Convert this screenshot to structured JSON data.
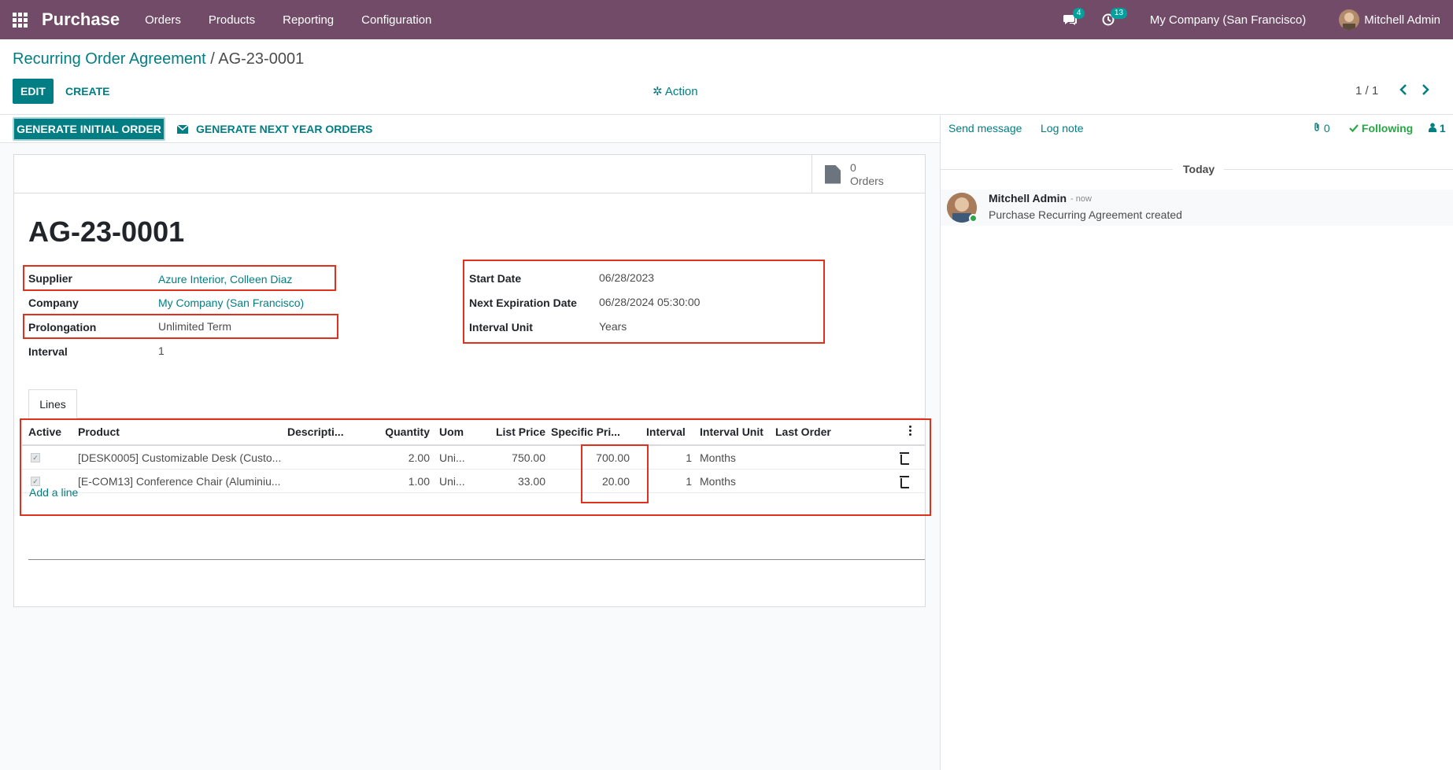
{
  "navbar": {
    "app_name": "Purchase",
    "menu": [
      "Orders",
      "Products",
      "Reporting",
      "Configuration"
    ],
    "messages_count": "4",
    "activities_count": "13",
    "company": "My Company (San Francisco)",
    "user": "Mitchell Admin"
  },
  "breadcrumb": {
    "parent": "Recurring Order Agreement",
    "separator": " / ",
    "current": "AG-23-0001"
  },
  "control_panel": {
    "edit_label": "EDIT",
    "create_label": "CREATE",
    "action_label": "✲ Action",
    "pager": "1 / 1"
  },
  "statusbar": {
    "generate_initial": "GENERATE INITIAL ORDER",
    "generate_next": "GENERATE NEXT YEAR ORDERS"
  },
  "stat_button": {
    "value": "0",
    "label": "Orders"
  },
  "record": {
    "name": "AG-23-0001",
    "left_fields": [
      {
        "label": "Supplier",
        "value": "Azure Interior, Colleen Diaz"
      },
      {
        "label": "Company",
        "value": "My Company (San Francisco)"
      },
      {
        "label": "Prolongation",
        "value": "Unlimited Term"
      },
      {
        "label": "Interval",
        "value": "1"
      }
    ],
    "right_fields": [
      {
        "label": "Start Date",
        "value": "06/28/2023"
      },
      {
        "label": "Next Expiration Date",
        "value": "06/28/2024 05:30:00"
      },
      {
        "label": "Interval Unit",
        "value": "Years"
      }
    ]
  },
  "tabs": {
    "lines": "Lines"
  },
  "lines_table": {
    "headers": [
      "Active",
      "Product",
      "Descripti...",
      "Quantity",
      "Uom",
      "List Price",
      "Specific Pri...",
      "Interval",
      "Interval Unit",
      "Last Order"
    ],
    "rows": [
      {
        "active": "✓",
        "product": "[DESK0005] Customizable Desk (Custo...",
        "description": "",
        "quantity": "2.00",
        "uom": "Uni...",
        "list_price": "750.00",
        "specific_price": "700.00",
        "interval": "1",
        "interval_unit": "Months",
        "last_order": ""
      },
      {
        "active": "✓",
        "product": "[E-COM13] Conference Chair (Aluminiu...",
        "description": "",
        "quantity": "1.00",
        "uom": "Uni...",
        "list_price": "33.00",
        "specific_price": "20.00",
        "interval": "1",
        "interval_unit": "Months",
        "last_order": ""
      }
    ],
    "add_line": "Add a line"
  },
  "chatter": {
    "send_message": "Send message",
    "log_note": "Log note",
    "attachments": "0",
    "following": "Following",
    "followers": "1",
    "date_separator": "Today",
    "messages": [
      {
        "author": "Mitchell Admin",
        "date": "- now",
        "body": "Purchase Recurring Agreement created"
      }
    ]
  },
  "colors": {
    "navbar": "#714b67",
    "primary": "#017e84",
    "highlight": "#e0301e"
  }
}
